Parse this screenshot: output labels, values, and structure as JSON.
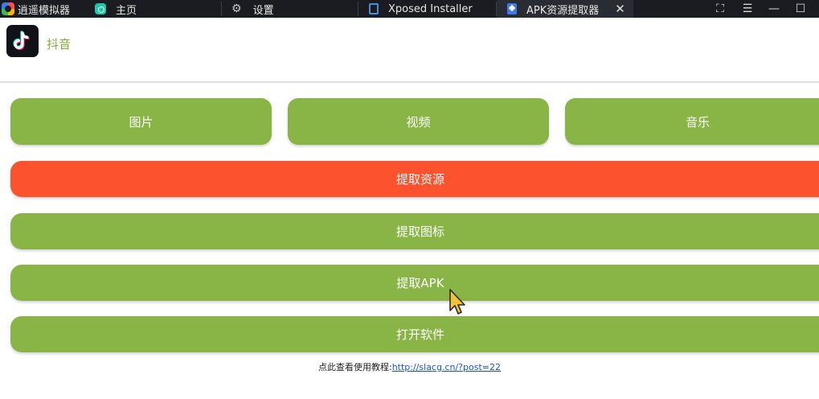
{
  "titlebar": {
    "app_name": "逍遥模拟器",
    "tabs": [
      {
        "label": "主页",
        "icon": "home-icon"
      },
      {
        "label": "设置",
        "icon": "gear-icon"
      },
      {
        "label": "Xposed Installer",
        "icon": "xposed-icon"
      },
      {
        "label": "APK资源提取器",
        "icon": "apk-icon",
        "active": true
      }
    ],
    "close_glyph": "✕",
    "controls": {
      "fullscreen": "⛶",
      "menu": "☰",
      "minimize": "—",
      "maximize": "☐"
    }
  },
  "app": {
    "name": "抖音",
    "icon": "tiktok-icon"
  },
  "buttons": {
    "images": "图片",
    "videos": "视频",
    "music": "音乐",
    "extract_resources": "提取资源",
    "extract_icon": "提取图标",
    "extract_apk": "提取APK",
    "open_app": "打开软件"
  },
  "footer": {
    "prefix": "点此查看使用教程:",
    "link": "http://slacg.cn/?post=22"
  },
  "colors": {
    "green": "#88b545",
    "red": "#fc532e",
    "titlebar": "#1b1c21",
    "accent_text": "#7caf3c"
  }
}
